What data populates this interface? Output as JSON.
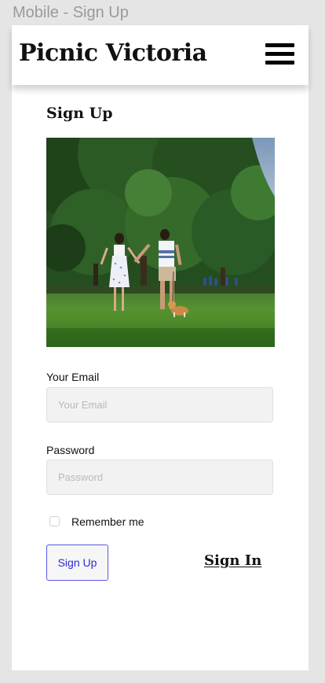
{
  "frame_label": "Mobile - Sign Up",
  "header": {
    "brand": "Picnic Victoria",
    "menu_icon": "hamburger-menu-icon"
  },
  "page": {
    "title": "Sign Up"
  },
  "form": {
    "email_label": "Your Email",
    "email_placeholder": "Your Email",
    "email_value": "",
    "password_label": "Password",
    "password_placeholder": "Password",
    "password_value": "",
    "remember_label": "Remember me",
    "remember_checked": false,
    "signup_button": "Sign Up",
    "signin_link": "Sign In"
  },
  "colors": {
    "button_border": "#5a58e6",
    "button_text": "#2b2bd0",
    "field_bg": "#f2f2f2",
    "canvas_bg": "#e5e5e5"
  }
}
